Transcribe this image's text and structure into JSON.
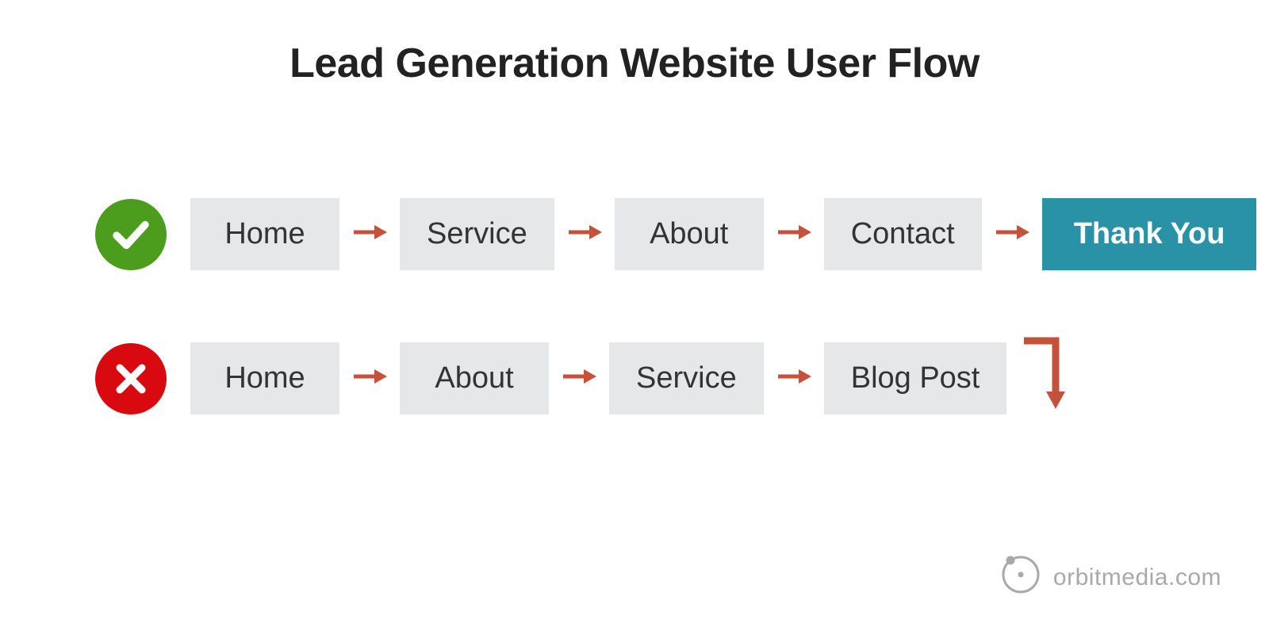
{
  "title": "Lead Generation Website User Flow",
  "colors": {
    "step_bg": "#e6e7e8",
    "step_text": "#333333",
    "final_bg": "#2a92a6",
    "final_text": "#ffffff",
    "arrow": "#c4513a",
    "good": "#4c9d1e",
    "bad": "#d90910",
    "footer": "#a7a9ab"
  },
  "good_flow": {
    "status": "good",
    "steps": [
      "Home",
      "Service",
      "About",
      "Contact"
    ],
    "final": "Thank You"
  },
  "bad_flow": {
    "status": "bad",
    "steps": [
      "Home",
      "About",
      "Service",
      "Blog Post"
    ],
    "exit": true
  },
  "footer": {
    "brand": "orbitmedia.com"
  }
}
